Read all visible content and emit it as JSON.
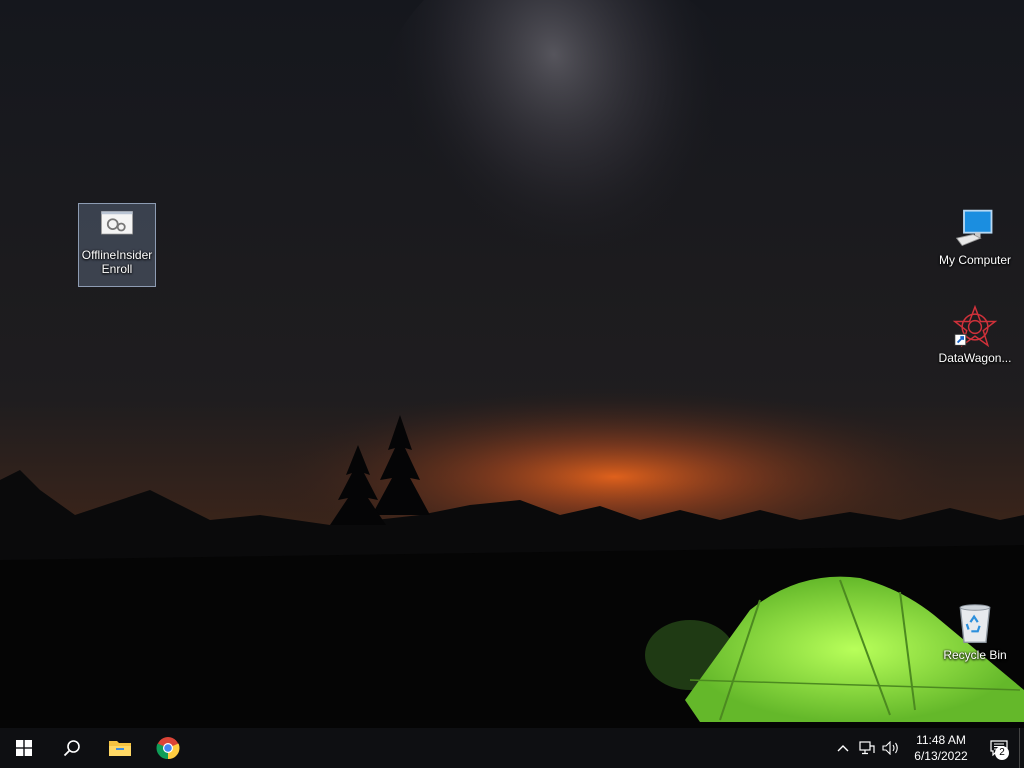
{
  "desktop": {
    "icons": [
      {
        "label": "OfflineInsider Enroll",
        "icon": "script-gears-icon"
      },
      {
        "label": "My Computer",
        "icon": "computer-icon"
      },
      {
        "label": "DataWagon...",
        "icon": "datawagon-icon"
      },
      {
        "label": "Recycle Bin",
        "icon": "recycle-bin-icon"
      }
    ]
  },
  "taskbar": {
    "buttons": [
      {
        "name": "start",
        "icon": "windows-icon"
      },
      {
        "name": "search",
        "icon": "search-icon"
      },
      {
        "name": "file-explorer",
        "icon": "folder-icon"
      },
      {
        "name": "chrome",
        "icon": "chrome-icon"
      }
    ],
    "tray": {
      "time": "11:48 AM",
      "date": "6/13/2022",
      "notification_count": "2"
    }
  },
  "colors": {
    "taskbar": "#0e0f12",
    "tent": "#8fe03a",
    "sky_glow": "#e8641c"
  }
}
